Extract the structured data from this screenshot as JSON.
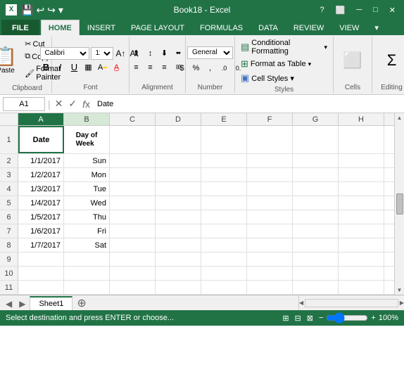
{
  "titlebar": {
    "title": "Book18 - Excel",
    "save_label": "💾",
    "undo_label": "↩",
    "redo_label": "↪"
  },
  "tabs": {
    "items": [
      "FILE",
      "HOME",
      "INSERT",
      "PAGE LAYOUT",
      "FORMULAS",
      "DATA",
      "REVIEW",
      "VIEW"
    ],
    "active": "HOME"
  },
  "ribbon": {
    "clipboard": {
      "label": "Clipboard",
      "paste": "Paste",
      "cut": "Cut",
      "copy": "Copy",
      "format_painter": "Format Painter"
    },
    "font": {
      "label": "Font",
      "font_name": "Calibri",
      "font_size": "11",
      "bold": "B",
      "italic": "I",
      "underline": "U"
    },
    "alignment": {
      "label": "Alignment"
    },
    "number": {
      "label": "Number",
      "format": "%"
    },
    "styles": {
      "label": "Styles",
      "conditional": "Conditional Formatting",
      "format_table": "Format as Table",
      "cell_styles": "Cell Styles ▾"
    },
    "cells": {
      "label": "Cells"
    },
    "editing": {
      "label": "Editing"
    }
  },
  "formulabar": {
    "cell_ref": "A1",
    "formula_value": "Date",
    "cancel_btn": "✕",
    "confirm_btn": "✓",
    "fx_label": "fx"
  },
  "spreadsheet": {
    "columns": [
      "A",
      "B",
      "C",
      "D",
      "E",
      "F",
      "G",
      "H"
    ],
    "rows": [
      {
        "num": 1,
        "cells": [
          "Date",
          "Day of\nWeek",
          "",
          "",
          "",
          "",
          "",
          ""
        ]
      },
      {
        "num": 2,
        "cells": [
          "1/1/2017",
          "Sun",
          "",
          "",
          "",
          "",
          "",
          ""
        ]
      },
      {
        "num": 3,
        "cells": [
          "1/2/2017",
          "Mon",
          "",
          "",
          "",
          "",
          "",
          ""
        ]
      },
      {
        "num": 4,
        "cells": [
          "1/3/2017",
          "Tue",
          "",
          "",
          "",
          "",
          "",
          ""
        ]
      },
      {
        "num": 5,
        "cells": [
          "1/4/2017",
          "Wed",
          "",
          "",
          "",
          "",
          "",
          ""
        ]
      },
      {
        "num": 6,
        "cells": [
          "1/5/2017",
          "Thu",
          "",
          "",
          "",
          "",
          "",
          ""
        ]
      },
      {
        "num": 7,
        "cells": [
          "1/6/2017",
          "Fri",
          "",
          "",
          "",
          "",
          "",
          ""
        ]
      },
      {
        "num": 8,
        "cells": [
          "1/7/2017",
          "Sat",
          "",
          "",
          "",
          "",
          "",
          ""
        ]
      },
      {
        "num": 9,
        "cells": [
          "",
          "",
          "",
          "",
          "",
          "",
          "",
          ""
        ]
      },
      {
        "num": 10,
        "cells": [
          "",
          "",
          "",
          "",
          "",
          "",
          "",
          ""
        ]
      },
      {
        "num": 11,
        "cells": [
          "",
          "",
          "",
          "",
          "",
          "",
          "",
          ""
        ]
      }
    ]
  },
  "sheet_tabs": {
    "sheets": [
      "Sheet1"
    ],
    "active": "Sheet1",
    "add_label": "+"
  },
  "statusbar": {
    "message": "Select destination and press ENTER or choose...",
    "zoom": "100%"
  }
}
